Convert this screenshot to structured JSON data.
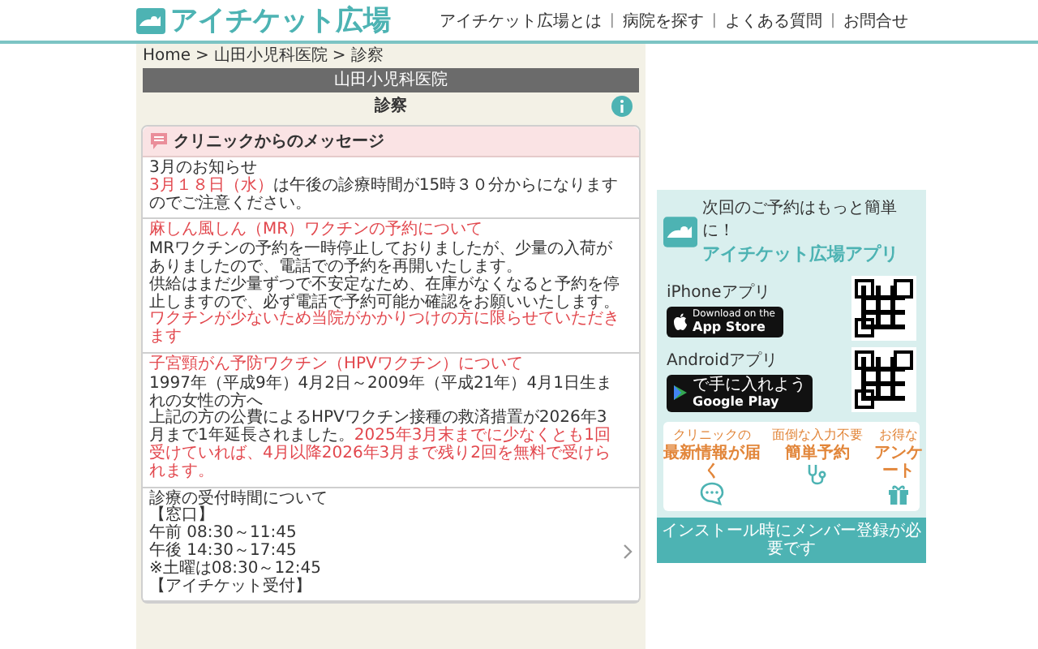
{
  "header": {
    "logo_text": "アイチケット広場",
    "nav": [
      "アイチケット広場とは",
      "病院を探す",
      "よくある質問",
      "お問合せ"
    ],
    "nav_separator": "|"
  },
  "breadcrumb": {
    "items": [
      "Home",
      "山田小児科医院",
      "診察"
    ],
    "separator": ">"
  },
  "clinic_name": "山田小児科医院",
  "page_title": "診察",
  "messages": {
    "title": "クリニックからのメッセージ",
    "sections": [
      {
        "kind": "notice",
        "blocks": [
          {
            "kind": "text",
            "spans": [
              {
                "text": "3月のお知らせ",
                "highlight": false
              }
            ]
          },
          {
            "kind": "text",
            "spans": [
              {
                "text": "3月１８日（水）",
                "highlight": true
              },
              {
                "text": "は午後の診療時間が15時３０分からになりますのでご注意ください。",
                "highlight": false
              }
            ]
          }
        ]
      },
      {
        "kind": "notice",
        "blocks": [
          {
            "kind": "heading",
            "spans": [
              {
                "text": "麻しん風しん（MR）ワクチンの予約について",
                "highlight": true
              }
            ]
          },
          {
            "kind": "text",
            "spans": [
              {
                "text": "MRワクチンの予約を一時停止しておりましたが、少量の入荷がありましたので、電話での予約を再開いたします。",
                "highlight": false
              }
            ]
          },
          {
            "kind": "text",
            "spans": [
              {
                "text": "供給はまだ少量ずつで不安定なため、在庫がなくなると予約を停止しますので、必ず電話で予約可能か確認をお願いいたします。",
                "highlight": false
              }
            ]
          },
          {
            "kind": "text",
            "spans": [
              {
                "text": "ワクチンが少ないため当院がかかりつけの方に限らせていただきます",
                "highlight": true
              }
            ]
          }
        ]
      },
      {
        "kind": "notice",
        "blocks": [
          {
            "kind": "heading",
            "spans": [
              {
                "text": "子宮頸がん予防ワクチン（HPVワクチン）について",
                "highlight": true
              }
            ]
          },
          {
            "kind": "text",
            "spans": [
              {
                "text": "1997年（平成9年）4月2日～2009年（平成21年）4月1日生まれの女性の方へ",
                "highlight": false
              }
            ]
          },
          {
            "kind": "text",
            "spans": [
              {
                "text": "上記の方の公費によるHPVワクチン接種の救済措置が2026年3月まで1年延長されました。",
                "highlight": false
              },
              {
                "text": "2025年3月末までに少なくとも1回受けていれば、4月以降2026年3月まで残り2回を無料で受けられます。",
                "highlight": true
              }
            ]
          }
        ]
      },
      {
        "kind": "link",
        "blocks": [
          {
            "kind": "text",
            "spans": [
              {
                "text": "診療の受付時間について",
                "highlight": false
              }
            ]
          },
          {
            "kind": "text",
            "spans": [
              {
                "text": "【窓口】",
                "highlight": false
              }
            ]
          },
          {
            "kind": "text",
            "spans": [
              {
                "text": "午前 08:30～11:45",
                "highlight": false
              }
            ]
          },
          {
            "kind": "text",
            "spans": [
              {
                "text": "午後 14:30～17:45",
                "highlight": false
              }
            ]
          },
          {
            "kind": "text",
            "spans": [
              {
                "text": "※土曜は08:30～12:45",
                "highlight": false
              }
            ]
          },
          {
            "kind": "text",
            "spans": [
              {
                "text": "【アイチケット受付】",
                "highlight": false
              }
            ]
          }
        ]
      }
    ]
  },
  "app_banner": {
    "tagline": "次回のご予約はもっと簡単に！",
    "app_name": "アイチケット広場アプリ",
    "stores": [
      {
        "kind": "apple",
        "label": "iPhoneアプリ",
        "badge_small": "Download on the",
        "badge_large": "App Store"
      },
      {
        "kind": "google",
        "label": "Androidアプリ",
        "badge_small": "で手に入れよう",
        "badge_large": "Google Play"
      }
    ],
    "features": [
      {
        "kind": "chat",
        "top": "クリニックの",
        "main": "最新情報が届く"
      },
      {
        "kind": "stethoscope",
        "top": "面倒な入力不要",
        "main": "簡単予約"
      },
      {
        "kind": "gift",
        "top": "お得な",
        "main": "アンケート"
      }
    ],
    "footer": "インストール時にメンバー登録が必要です"
  }
}
